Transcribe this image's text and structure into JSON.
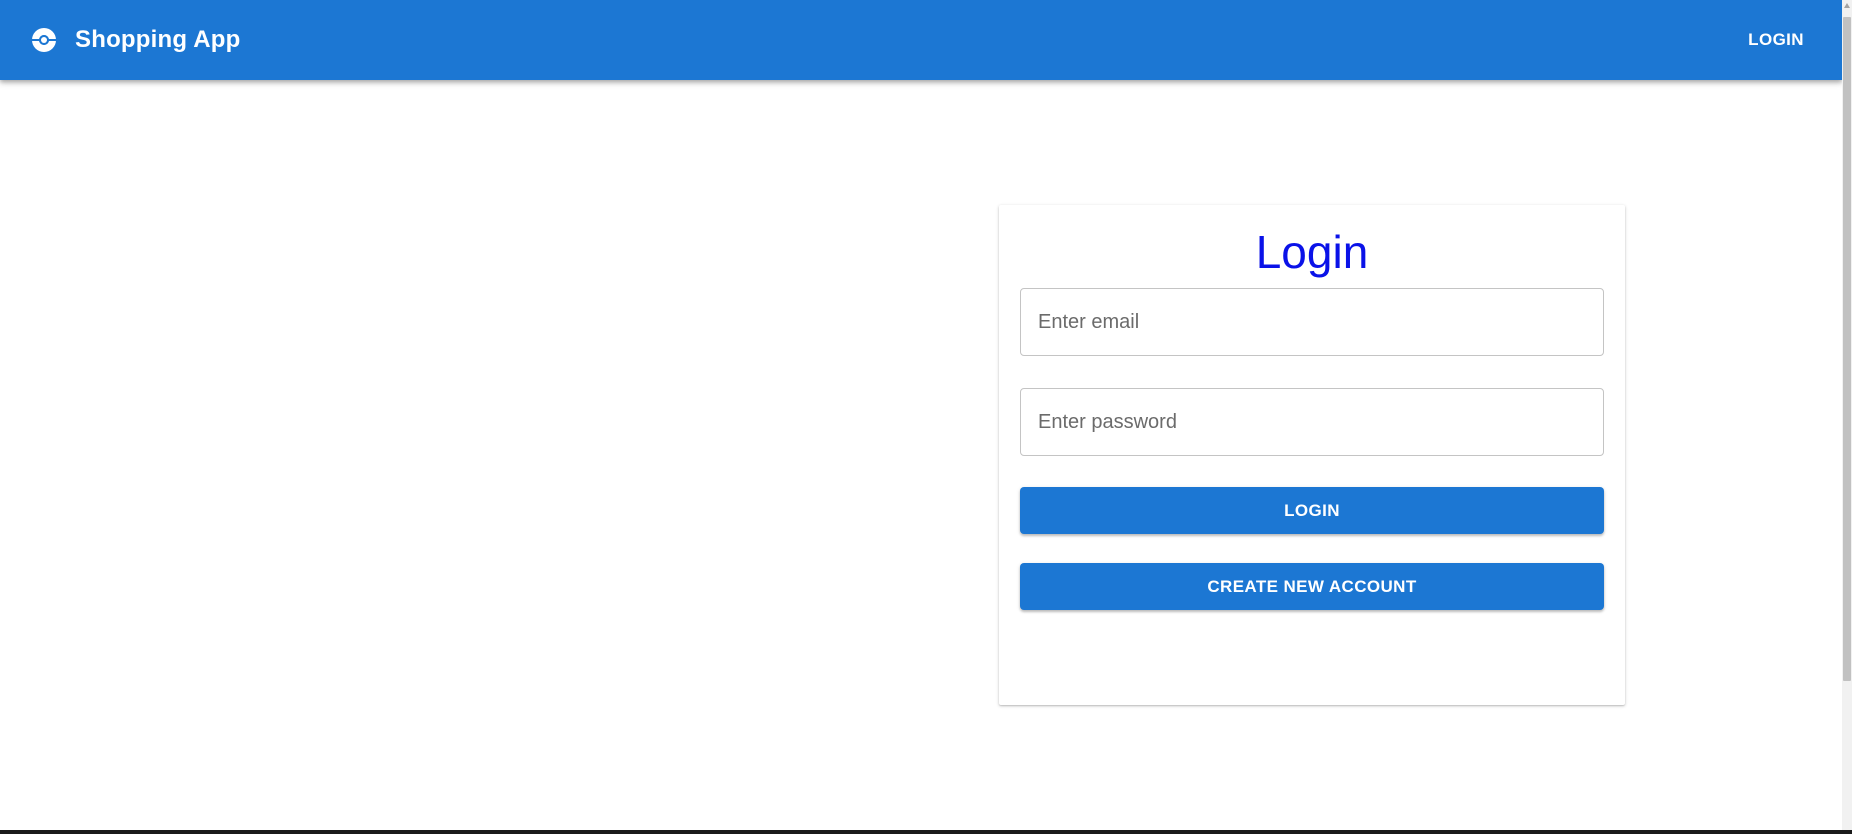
{
  "appbar": {
    "brand_icon": "pokeball-icon",
    "title": "Shopping App",
    "nav_login_label": "LOGIN",
    "color": "#1c77d3"
  },
  "login_card": {
    "title": "Login",
    "title_color": "#0a12e8",
    "email": {
      "value": "",
      "placeholder": "Enter email"
    },
    "password": {
      "value": "",
      "placeholder": "Enter password"
    },
    "login_button_label": "LOGIN",
    "create_account_button_label": "CREATE NEW ACCOUNT",
    "button_color": "#1c77d3"
  }
}
